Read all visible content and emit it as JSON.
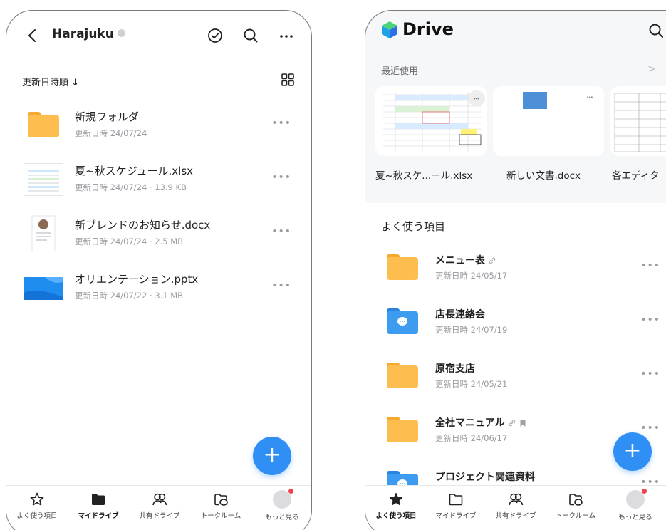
{
  "left": {
    "header": {
      "title": "Harajuku"
    },
    "sort_label": "更新日時順 ↓",
    "files": [
      {
        "name": "新規フォルダ",
        "meta": "更新日時 24/07/24",
        "kind": "folder"
      },
      {
        "name": "夏~秋スケジュール.xlsx",
        "meta": "更新日時 24/07/24 · 13.9 KB",
        "kind": "xlsx"
      },
      {
        "name": "新ブレンドのお知らせ.docx",
        "meta": "更新日時 24/07/24 · 2.5 MB",
        "kind": "docx"
      },
      {
        "name": "オリエンテーション.pptx",
        "meta": "更新日時 24/07/22 · 3.1 MB",
        "kind": "pptx"
      }
    ],
    "fab_label": "+",
    "tabs": [
      {
        "label": "よく使う項目",
        "icon": "star-outline-icon"
      },
      {
        "label": "マイドライブ",
        "icon": "folder-filled-icon",
        "active": true
      },
      {
        "label": "共有ドライブ",
        "icon": "people-icon"
      },
      {
        "label": "トークルーム",
        "icon": "chat-folder-icon"
      },
      {
        "label": "もっと見る",
        "icon": "avatar-icon"
      }
    ]
  },
  "right": {
    "header": {
      "title": "Drive"
    },
    "recent_label": "最近使用",
    "recent_chevron": ">",
    "recent_items": [
      {
        "label": "夏~秋スケ...ール.xlsx"
      },
      {
        "label": "新しい文書.docx"
      },
      {
        "label": "各エディタ"
      }
    ],
    "favorites_label": "よく使う項目",
    "favorites": [
      {
        "name": "メニュー表",
        "meta": "更新日時 24/05/17",
        "type": "folder",
        "link": true,
        "bookmark": false
      },
      {
        "name": "店長連絡会",
        "meta": "更新日時 24/07/19",
        "type": "talk-folder",
        "link": false,
        "bookmark": false
      },
      {
        "name": "原宿支店",
        "meta": "更新日時 24/05/21",
        "type": "folder",
        "link": false,
        "bookmark": false
      },
      {
        "name": "全社マニュアル",
        "meta": "更新日時 24/06/17",
        "type": "folder",
        "link": true,
        "bookmark": true
      },
      {
        "name": "プロジェクト関連資料",
        "meta": "",
        "type": "talk-folder",
        "link": false,
        "bookmark": false
      }
    ],
    "fab_label": "+",
    "tabs": [
      {
        "label": "よく使う項目",
        "icon": "star-filled-icon",
        "active": true
      },
      {
        "label": "マイドライブ",
        "icon": "folder-outline-icon"
      },
      {
        "label": "共有ドライブ",
        "icon": "people-icon"
      },
      {
        "label": "トークルーム",
        "icon": "chat-folder-icon"
      },
      {
        "label": "もっと見る",
        "icon": "avatar-icon"
      }
    ]
  },
  "colors": {
    "accent": "#2f8ff5",
    "folder_yellow": "#fdbd4f",
    "folder_blue": "#3d9bf0",
    "notification": "#f3424d"
  }
}
